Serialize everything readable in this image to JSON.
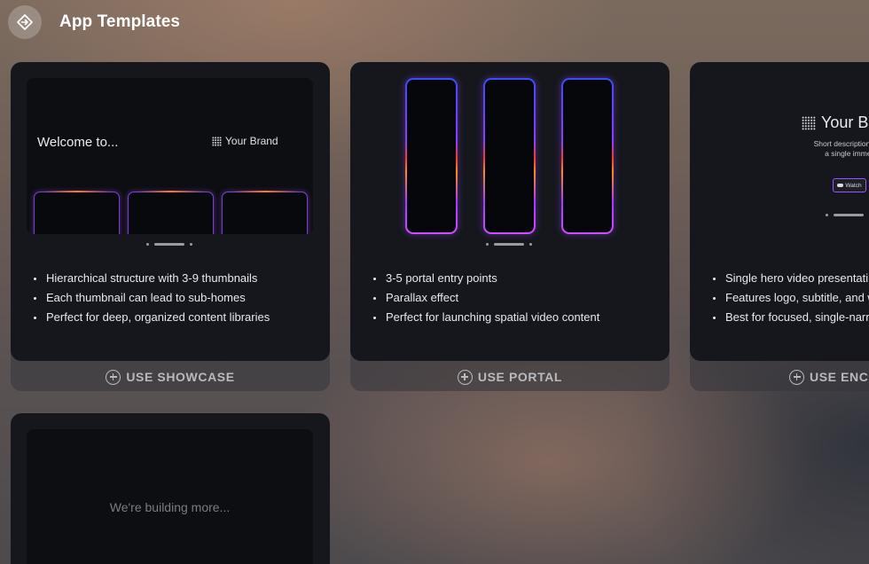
{
  "header": {
    "title": "App Templates",
    "back_icon": "diamond-arrow-icon"
  },
  "cards": [
    {
      "preview": {
        "welcome": "Welcome to...",
        "brand": "Your Brand"
      },
      "bullets": [
        "Hierarchical structure with 3-9 thumbnails",
        "Each thumbnail can lead to sub-homes",
        "Perfect for deep, organized content libraries"
      ],
      "button": "USE SHOWCASE"
    },
    {
      "bullets": [
        "3-5 portal entry points",
        "Parallax effect",
        "Perfect for launching spatial video content"
      ],
      "button": "USE PORTAL"
    },
    {
      "preview": {
        "brand": "Your B",
        "desc_line1": "Short description of the purp",
        "desc_line2": "a single immersive ex",
        "watch": "Watch"
      },
      "bullets": [
        "Single hero video presentati",
        "Features logo, subtitle, and w",
        "Best for focused, single-narr"
      ],
      "button": "USE ENCO"
    },
    {
      "placeholder": "We're building more..."
    }
  ]
}
